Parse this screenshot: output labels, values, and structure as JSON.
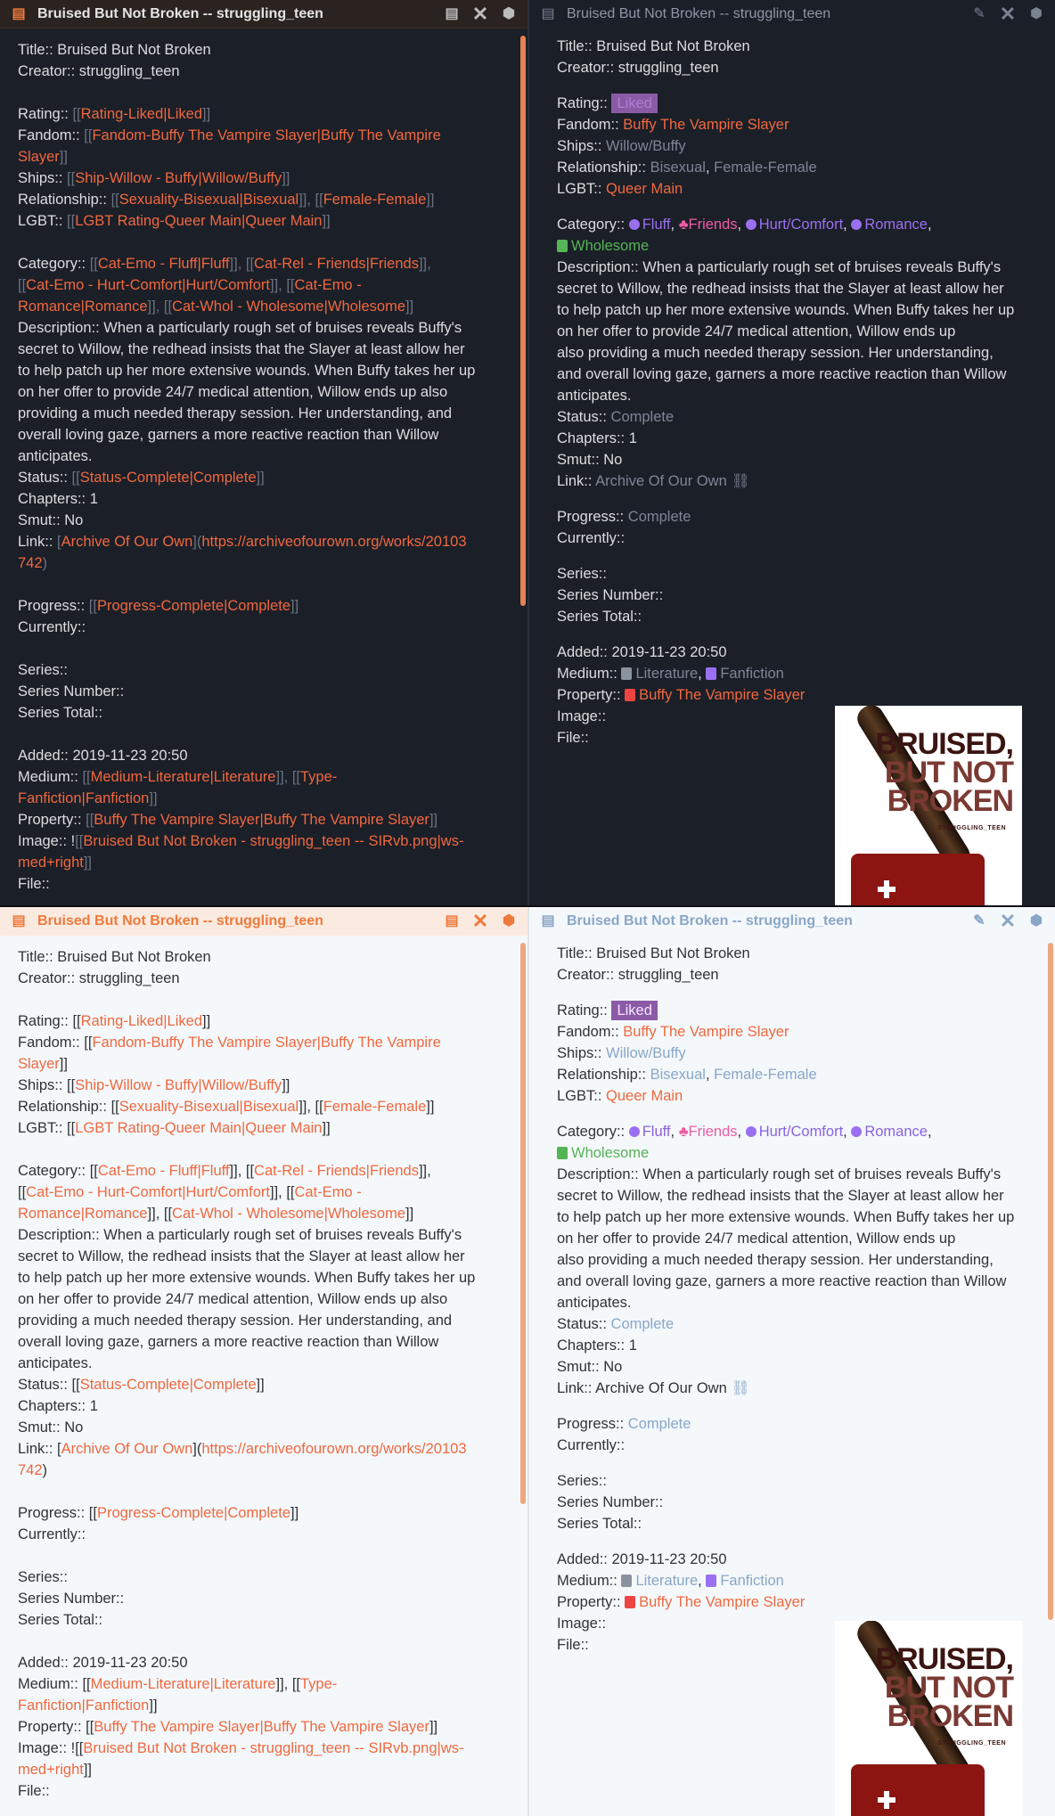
{
  "tab_title": "Bruised But Not Broken -- struggling_teen",
  "source": {
    "title": "Title:: Bruised But Not Broken",
    "creator": "Creator:: struggling_teen",
    "rating_key": "Rating:: ",
    "rating_open": "[[",
    "rating_link": "Rating-Liked|Liked",
    "close": "]]",
    "fandom_key": "Fandom:: ",
    "fandom_link_a": "Fandom-Buffy The Vampire Slayer|Buffy The Vampire",
    "fandom_link_b": "Slayer",
    "ships_key": "Ships:: ",
    "ships_link": "Ship-Willow - Buffy|Willow/Buffy",
    "relationship_key": "Relationship:: ",
    "rel_link1": "Sexuality-Bisexual|Bisexual",
    "rel_sep": "]], [[",
    "rel_link2": "Female-Female",
    "lgbt_key": "LGBT:: ",
    "lgbt_link": "LGBT Rating-Queer Main|Queer Main",
    "category_key": "Category:: ",
    "cat1": "Cat-Emo - Fluff|Fluff",
    "cat2": "Cat-Rel - Friends|Friends",
    "cat3": "Cat-Emo - Hurt-Comfort|Hurt/Comfort",
    "cat4a": "Cat-Emo -",
    "cat4b": "Romance|Romance",
    "cat5": "Cat-Whol - Wholesome|Wholesome",
    "desc1": "Description:: When a particularly rough set of bruises reveals Buffy's",
    "desc2": "secret to Willow, the redhead insists that the Slayer at least allow her",
    "desc3": "to help patch up her more extensive wounds. When Buffy takes her up",
    "desc4": "on her offer to provide 24/7 medical attention, Willow ends up also",
    "desc5": "providing a much needed therapy session. Her understanding, and",
    "desc6": "overall loving gaze, garners a more reactive reaction than Willow",
    "desc7": "anticipates.",
    "status_key": "Status:: ",
    "status_link": "Status-Complete|Complete",
    "chapters": "Chapters:: 1",
    "smut": "Smut:: No",
    "link_key": "Link:: ",
    "link_open": "[",
    "link_text": "Archive Of Our Own",
    "link_mid": "](",
    "link_url_a": "https://archiveofourown.org/works/20103",
    "link_url_b": "742",
    "link_close": ")",
    "progress_key": "Progress:: ",
    "progress_link": "Progress-Complete|Complete",
    "currently": "Currently::",
    "series": "Series::",
    "series_number": "Series Number::",
    "series_total": "Series Total::",
    "added": "Added:: 2019-11-23 20:50",
    "medium_key": "Medium:: ",
    "medium_link1": "Medium-Literature|Literature",
    "medium_link2a": "Type-",
    "medium_link2b": "Fanfiction|Fanfiction",
    "property_key": "Property:: ",
    "property_link": "Buffy The Vampire Slayer|Buffy The Vampire Slayer",
    "image_key": "Image:: ",
    "image_bang": "!",
    "image_link_a": "Bruised But Not Broken - struggling_teen -- SIRvb.png|ws-",
    "image_link_b": "med+right",
    "file": "File::"
  },
  "preview": {
    "title": "Title:: Bruised But Not Broken",
    "creator": "Creator:: struggling_teen",
    "rating_key": "Rating:: ",
    "rating": "Liked",
    "fandom_key": "Fandom:: ",
    "fandom": "Buffy The Vampire Slayer",
    "ships_key": "Ships:: ",
    "ships": "Willow/Buffy",
    "relationship_key": "Relationship:: ",
    "rel1": "Bisexual",
    "comma": ", ",
    "rel2": "Female-Female",
    "lgbt_key": "LGBT:: ",
    "lgbt": "Queer Main",
    "category_key": "Category:: ",
    "cat_fluff": "Fluff",
    "cat_friends": "Friends",
    "cat_hurt": "Hurt/Comfort",
    "cat_romance": "Romance",
    "cat_wholesome": "Wholesome",
    "desc1": "Description:: When a particularly rough set of bruises reveals Buffy's",
    "desc2": "secret to Willow, the redhead insists that the Slayer at least allow her",
    "desc3": "to help patch up her more extensive wounds. When Buffy takes her up",
    "desc4": "on her offer to provide 24/7 medical attention, Willow ends up",
    "desc5": "also providing a much needed therapy session. Her understanding,",
    "desc6": "and overall loving gaze, garners a more reactive reaction than Willow",
    "desc7": "anticipates.",
    "status_key": "Status:: ",
    "status": "Complete",
    "chapters": "Chapters:: 1",
    "smut": "Smut:: No",
    "link_key": "Link:: ",
    "link": "Archive Of Our Own",
    "progress_key": "Progress:: ",
    "progress": "Complete",
    "currently": "Currently::",
    "series": "Series::",
    "series_number": "Series Number::",
    "series_total": "Series Total::",
    "added": "Added:: 2019-11-23 20:50",
    "medium_key": "Medium:: ",
    "medium1": "Literature",
    "medium2": "Fanfiction",
    "property_key": "Property:: ",
    "property": "Buffy The Vampire Slayer",
    "image_key": "Image::",
    "file": "File::"
  },
  "cover": {
    "line1": "BRUISED,",
    "line2": "BUT NOT",
    "line3": "BROKEN",
    "author": "STRUGGLING_TEEN"
  },
  "icons": {
    "file": "file-icon",
    "reading": "reading-view-icon",
    "close": "close-icon",
    "settings": "gear-icon",
    "edit": "pencil-icon",
    "external": "external-link-icon"
  },
  "colors": {
    "accent": "#f0683f",
    "tag_purple": "#9a70f0",
    "tag_pink": "#ef5ca4",
    "tag_green": "#55b455",
    "rating_bg": "#8b5aa6"
  }
}
